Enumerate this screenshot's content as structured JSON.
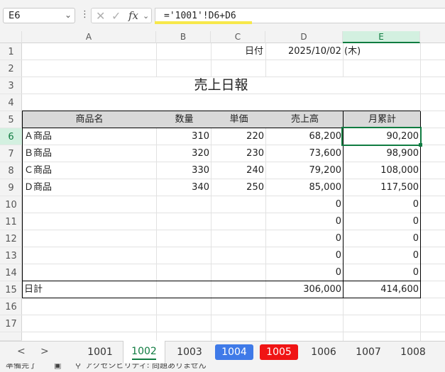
{
  "formula_bar": {
    "name_box": "E6",
    "formula": "='1001'!D6+D6",
    "icons": [
      "close-icon",
      "check-icon",
      "fx-icon"
    ]
  },
  "columns": [
    "A",
    "B",
    "C",
    "D",
    "E"
  ],
  "rows": [
    "1",
    "2",
    "3",
    "4",
    "5",
    "6",
    "7",
    "8",
    "9",
    "10",
    "11",
    "12",
    "13",
    "14",
    "15",
    "16",
    "17"
  ],
  "selected_cell": {
    "column": "E",
    "row": "6"
  },
  "sheet": {
    "date_label": "日付",
    "date_value": "2025/10/02 (木)",
    "title": "売上日報",
    "headers": [
      "商品名",
      "数量",
      "単価",
      "売上高",
      "月累計"
    ],
    "items": [
      {
        "name": "Ａ商品",
        "qty": "310",
        "price": "220",
        "sales": "68,200",
        "monthly": "90,200"
      },
      {
        "name": "Ｂ商品",
        "qty": "320",
        "price": "230",
        "sales": "73,600",
        "monthly": "98,900"
      },
      {
        "name": "Ｃ商品",
        "qty": "330",
        "price": "240",
        "sales": "79,200",
        "monthly": "108,000"
      },
      {
        "name": "Ｄ商品",
        "qty": "340",
        "price": "250",
        "sales": "85,000",
        "monthly": "117,500"
      },
      {
        "name": "",
        "qty": "",
        "price": "",
        "sales": "0",
        "monthly": "0"
      },
      {
        "name": "",
        "qty": "",
        "price": "",
        "sales": "0",
        "monthly": "0"
      },
      {
        "name": "",
        "qty": "",
        "price": "",
        "sales": "0",
        "monthly": "0"
      },
      {
        "name": "",
        "qty": "",
        "price": "",
        "sales": "0",
        "monthly": "0"
      },
      {
        "name": "",
        "qty": "",
        "price": "",
        "sales": "0",
        "monthly": "0"
      }
    ],
    "total": {
      "name": "日計",
      "sales": "306,000",
      "monthly": "414,600"
    }
  },
  "tabs": {
    "prev": "<",
    "next": ">",
    "items": [
      {
        "label": "1001",
        "style": "normal"
      },
      {
        "label": "1002",
        "style": "active"
      },
      {
        "label": "1003",
        "style": "normal"
      },
      {
        "label": "1004",
        "style": "blue"
      },
      {
        "label": "1005",
        "style": "red"
      },
      {
        "label": "1006",
        "style": "normal"
      },
      {
        "label": "1007",
        "style": "normal"
      },
      {
        "label": "1008",
        "style": "normal"
      }
    ]
  },
  "status": {
    "ready": "準備完了",
    "accessibility": "アクセシビリティ: 問題ありません"
  },
  "colors": {
    "accent": "#107c41",
    "tab_blue": "#3f7ae8",
    "tab_red": "#f01414",
    "header_fill": "#d9d9d9"
  }
}
